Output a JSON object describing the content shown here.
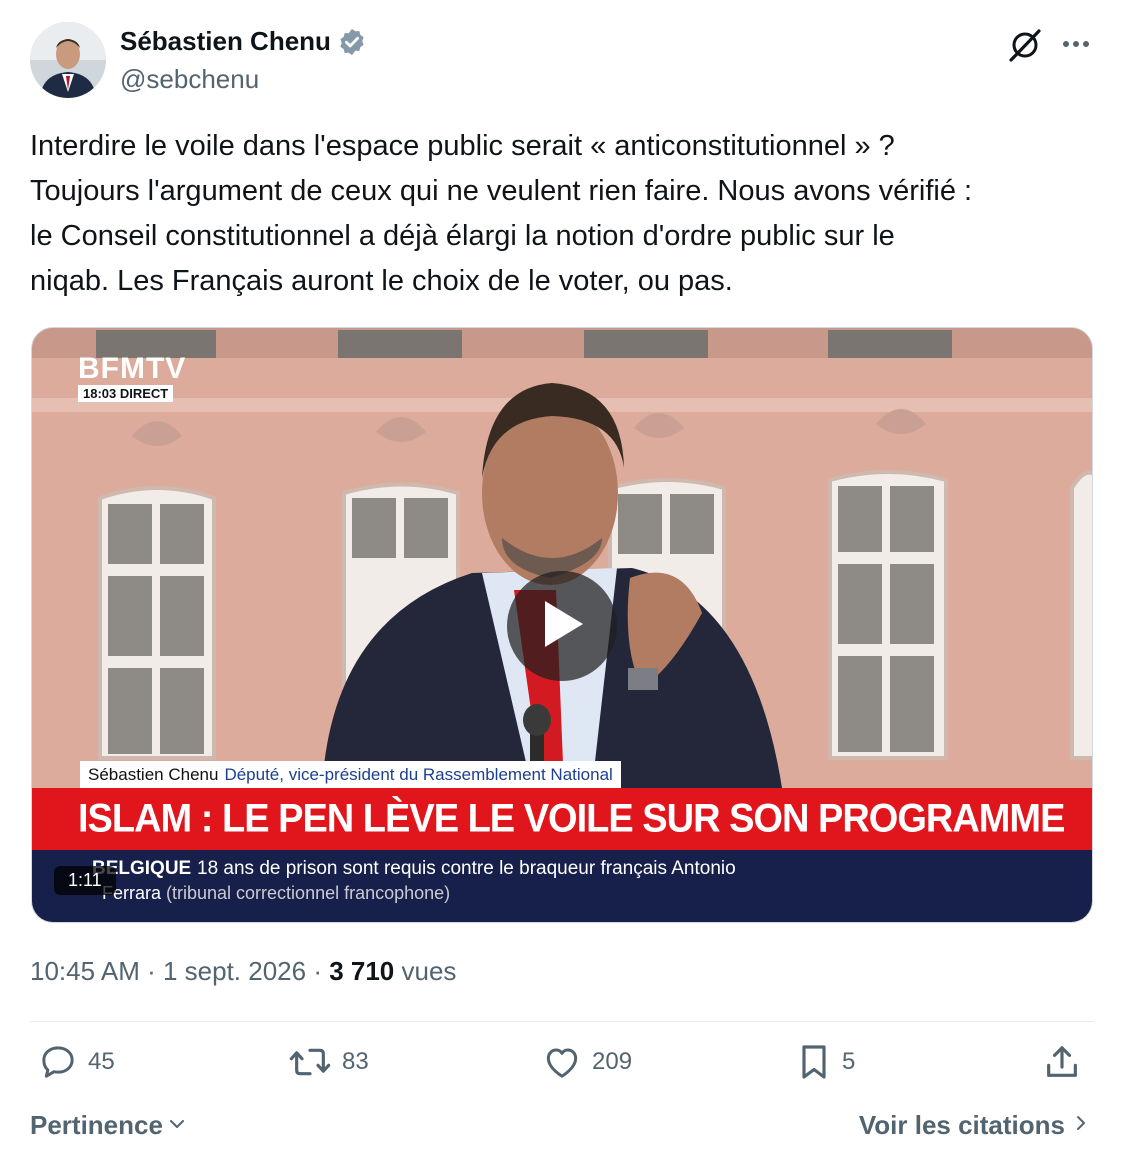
{
  "author": {
    "display_name": "Sébastien Chenu",
    "handle": "@sebchenu",
    "verified": true
  },
  "tweet": {
    "text": "Interdire le voile dans l'espace public serait « anticonstitutionnel » ?\nToujours l'argument de ceux qui ne veulent rien faire. Nous avons vérifié :\nle Conseil constitutionnel a déjà élargi la notion d'ordre public sur le\nniqab. Les Français auront le choix de le voter, ou pas."
  },
  "video": {
    "channel_logo": "BFMTV",
    "live_badge": "18:03  DIRECT",
    "lower_name": "Sébastien Chenu",
    "lower_role": "Député, vice-président du Rassemblement National",
    "headline": "ISLAM : LE PEN LÈVE LE VOILE SUR SON PROGRAMME",
    "ticker_tag": "BELGIQUE",
    "ticker_line1": "18 ans de prison sont requis contre le braqueur français Antonio",
    "ticker_name": "Ferrara",
    "ticker_line2_rest": " (tribunal correctionnel francophone)",
    "duration": "1:11",
    "play_icon": "play-icon"
  },
  "meta": {
    "time": "10:45 AM",
    "separator": " · ",
    "date": "1 sept. 2026",
    "views_count": "3 710",
    "views_label": " vues"
  },
  "actions": {
    "replies": "45",
    "reposts": "83",
    "likes": "209",
    "bookmarks": "5"
  },
  "footer": {
    "sort_label": "Pertinence",
    "quotes_label": "Voir les citations"
  },
  "colors": {
    "text_primary": "#0f1419",
    "text_secondary": "#536471",
    "verified_blue": "#8699a8",
    "headline_red": "#e1151c",
    "ticker_navy": "#16204a"
  }
}
